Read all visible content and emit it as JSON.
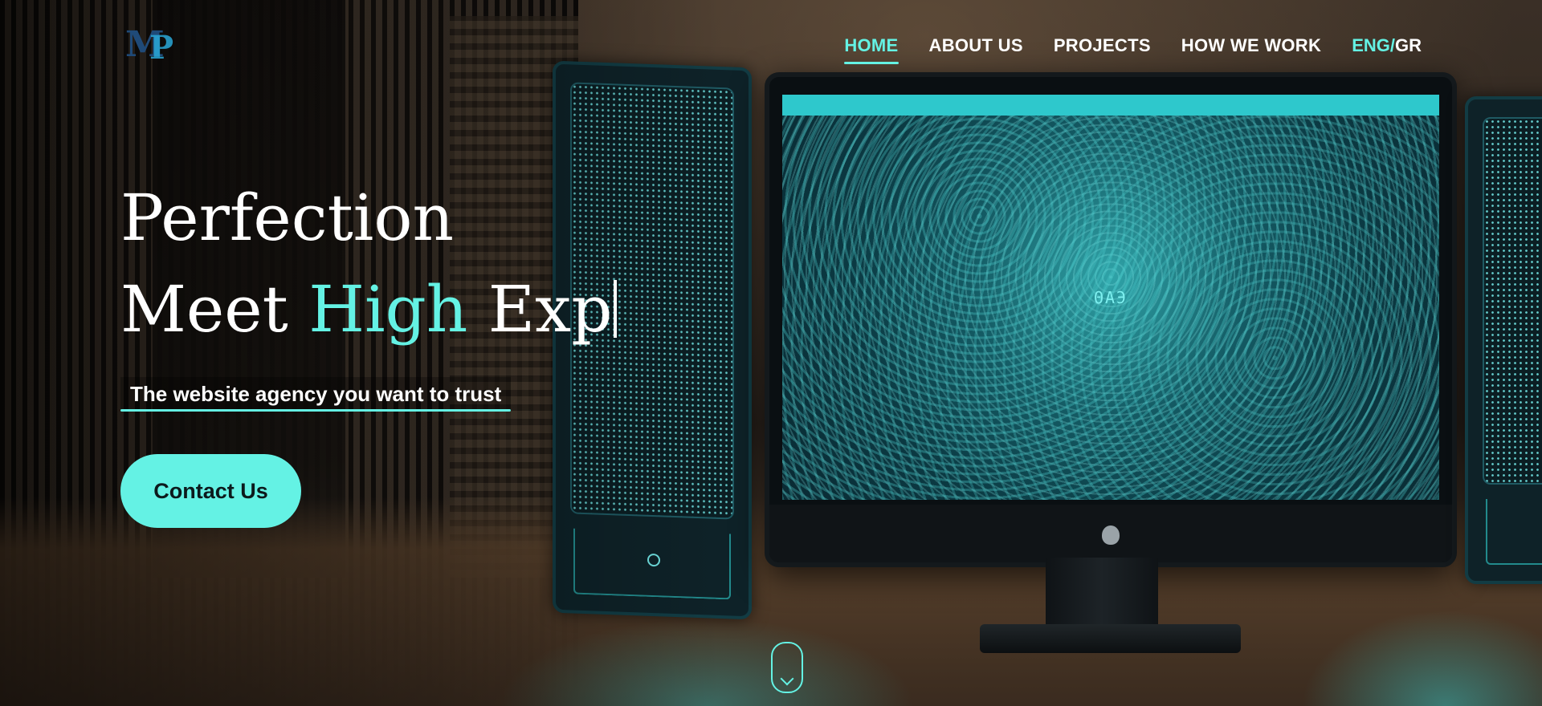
{
  "logo": {
    "letters_a": "M",
    "letters_b": "P"
  },
  "nav": {
    "items": [
      {
        "label": "HOME",
        "active": true
      },
      {
        "label": "ABOUT US",
        "active": false
      },
      {
        "label": "PROJECTS",
        "active": false
      },
      {
        "label": "HOW WE WORK",
        "active": false
      }
    ],
    "language": {
      "eng": "ENG",
      "separator": "/",
      "gr": "GR",
      "selected": "ENG"
    }
  },
  "hero": {
    "line1": "Perfection",
    "line2_part1": "Meet",
    "line2_highlight": "High",
    "line2_part2": "Exp",
    "tagline": "The website agency you want to trust",
    "cta_label": "Contact Us"
  },
  "monitor": {
    "screen_label": "ΘΑЭ"
  },
  "colors": {
    "accent": "#64f2e4",
    "text": "#ffffff",
    "cta_text": "#0c1a1c"
  }
}
